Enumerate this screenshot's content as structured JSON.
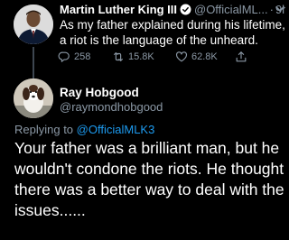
{
  "parent_tweet": {
    "author_name": "Martin Luther King III",
    "verified": true,
    "handle": "@OfficialML...",
    "separator": "·",
    "time": "9h",
    "text": "As my father explained during his lifetime, a riot is the language of the unheard.",
    "actions": {
      "reply_count": "258",
      "retweet_count": "15.8K",
      "like_count": "62.8K"
    }
  },
  "reply_tweet": {
    "author_name": "Ray Hobgood",
    "handle": "@raymondhobgood",
    "replying_prefix": "Replying to",
    "replying_handle": "@OfficialMLK3",
    "text": "Your father was a brilliant man, but he wouldn't condone the riots.  He thought there was a better way to deal with the issues......"
  },
  "colors": {
    "background": "#000000",
    "text_primary": "#ffffff",
    "text_secondary": "#8b98a5",
    "link": "#1d9bf0",
    "verified_badge": "#1d9bf0"
  }
}
